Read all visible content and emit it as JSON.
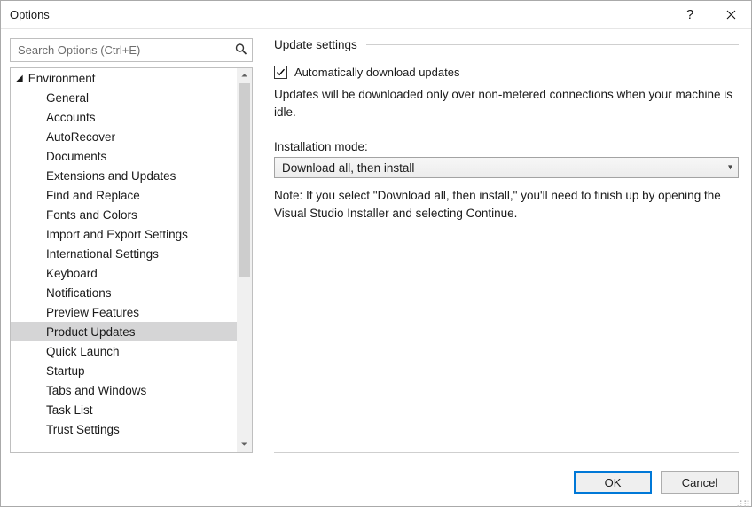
{
  "window": {
    "title": "Options"
  },
  "search": {
    "placeholder": "Search Options (Ctrl+E)"
  },
  "tree": {
    "root": "Environment",
    "items": [
      "General",
      "Accounts",
      "AutoRecover",
      "Documents",
      "Extensions and Updates",
      "Find and Replace",
      "Fonts and Colors",
      "Import and Export Settings",
      "International Settings",
      "Keyboard",
      "Notifications",
      "Preview Features",
      "Product Updates",
      "Quick Launch",
      "Startup",
      "Tabs and Windows",
      "Task List",
      "Trust Settings"
    ],
    "selected": "Product Updates"
  },
  "panel": {
    "section": "Update settings",
    "auto_checkbox": "Automatically download updates",
    "auto_checked": true,
    "auto_desc": "Updates will be downloaded only over non-metered connections when your machine is idle.",
    "mode_label": "Installation mode:",
    "mode_value": "Download all, then install",
    "mode_note": "Note: If you select \"Download all, then install,\" you'll need to finish up by opening the Visual Studio Installer and selecting Continue."
  },
  "buttons": {
    "ok": "OK",
    "cancel": "Cancel"
  }
}
